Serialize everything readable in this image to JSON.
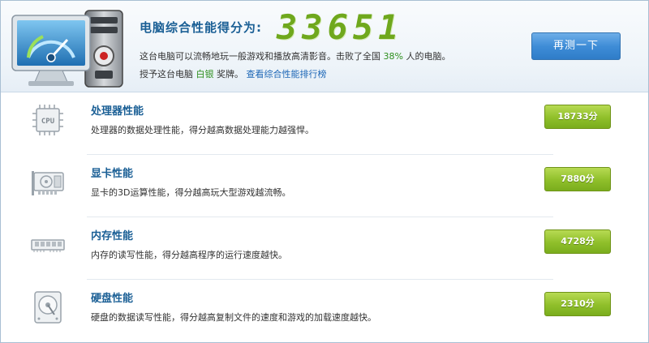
{
  "header": {
    "score_title": "电脑综合性能得分为:",
    "score": "33651",
    "desc_prefix": "这台电脑可以流畅地玩一般游戏和播放高清影音。击败了全国",
    "beat_percent": "38%",
    "desc_suffix": "人的电脑。",
    "award_prefix": "授予这台电脑",
    "award_level": "白银",
    "award_suffix": "奖牌。",
    "rank_link": "查看综合性能排行榜",
    "retest_label": "再测一下"
  },
  "rows": [
    {
      "name": "处理器性能",
      "desc": "处理器的数据处理性能，得分越高数据处理能力越强悍。",
      "score": "18733分",
      "icon": "cpu-icon"
    },
    {
      "name": "显卡性能",
      "desc": "显卡的3D运算性能，得分越高玩大型游戏越流畅。",
      "score": "7880分",
      "icon": "graphics-card-icon"
    },
    {
      "name": "内存性能",
      "desc": "内存的读写性能，得分越高程序的运行速度越快。",
      "score": "4728分",
      "icon": "memory-icon"
    },
    {
      "name": "硬盘性能",
      "desc": "硬盘的数据读写性能，得分越高复制文件的速度和游戏的加载速度越快。",
      "score": "2310分",
      "icon": "hard-disk-icon"
    }
  ],
  "colors": {
    "accent_blue": "#1a5f95",
    "score_green": "#6fa81d",
    "badge_green": "#8fbf2a",
    "button_blue": "#3f8dd7"
  }
}
